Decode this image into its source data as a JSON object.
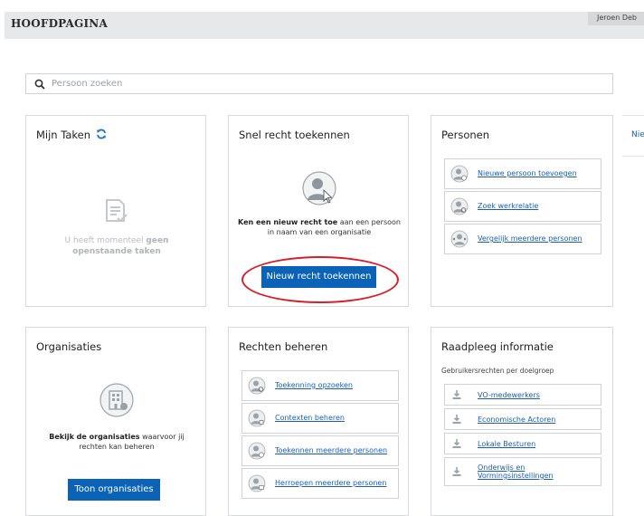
{
  "header": {
    "title": "HOOFDPAGINA",
    "user": "Jeroen Deb"
  },
  "search": {
    "placeholder": "Persoon zoeken",
    "icon": "search-icon"
  },
  "tasks": {
    "title": "Mijn Taken",
    "empty_prefix": "U heeft momenteel ",
    "empty_bold": "geen openstaande taken"
  },
  "quick": {
    "title": "Snel recht toekennen",
    "desc_bold": "Ken een nieuw recht toe",
    "desc_rest": " aan een persoon in naam van een organisatie",
    "button": "Nieuw recht toekennen"
  },
  "persons": {
    "title": "Personen",
    "items": [
      {
        "label": "Nieuwe persoon toevoegen",
        "icon": "person-add-icon"
      },
      {
        "label": "Zoek werkrelatie",
        "icon": "person-search-icon"
      },
      {
        "label": "Vergelijk meerdere personen",
        "icon": "person-compare-icon"
      }
    ]
  },
  "orgs": {
    "title": "Organisaties",
    "desc_bold": "Bekijk de organisaties",
    "desc_rest": " waarvoor jij rechten kan beheren",
    "button": "Toon organisaties"
  },
  "rights": {
    "title": "Rechten beheren",
    "items": [
      {
        "label": "Toekenning opzoeken"
      },
      {
        "label": "Contexten beheren"
      },
      {
        "label": "Toekennen meerdere personen"
      },
      {
        "label": "Herroepen meerdere personen"
      }
    ]
  },
  "info": {
    "title": "Raadpleeg informatie",
    "subtitle": "Gebruikersrechten per doelgroep",
    "items": [
      {
        "label": "VO-medewerkers"
      },
      {
        "label": "Economische Actoren"
      },
      {
        "label": "Lokale Besturen"
      },
      {
        "label": "Onderwijs en Vormingsinstellingen"
      }
    ]
  },
  "side": {
    "label": "Nie"
  },
  "colors": {
    "primary_button": "#0b63b8",
    "link": "#1a5fb4",
    "annotation": "#d4202a"
  }
}
